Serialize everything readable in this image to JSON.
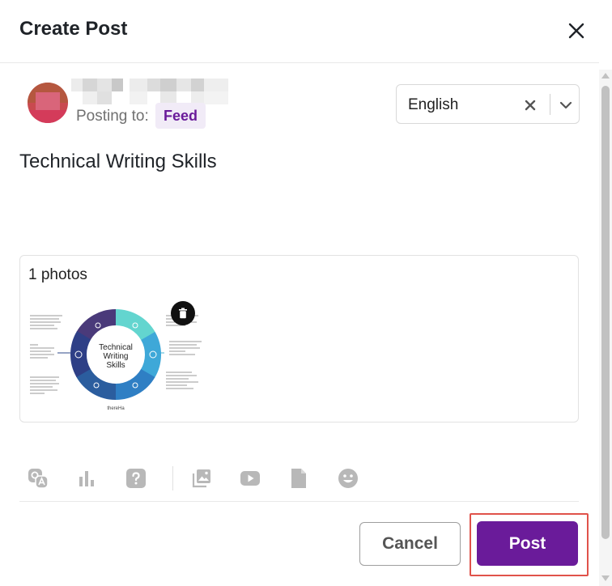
{
  "dialog": {
    "title": "Create Post",
    "close_icon": "close-icon"
  },
  "author": {
    "posting_to_label": "Posting to:",
    "destination": "Feed"
  },
  "language": {
    "selected": "English",
    "clear_icon": "clear-icon",
    "dropdown_icon": "chevron-down-icon"
  },
  "post": {
    "text": "Technical Writing Skills"
  },
  "attachments": {
    "count_label": "1 photos",
    "thumbnail": {
      "center_title": "Technical Writing Skills",
      "footer": "thereHa"
    },
    "delete_icon": "trash-icon"
  },
  "toolbar": {
    "tools": [
      {
        "icon": "qa-icon"
      },
      {
        "icon": "poll-icon"
      },
      {
        "icon": "question-icon"
      },
      {
        "icon": "photo-gallery-icon"
      },
      {
        "icon": "video-icon"
      },
      {
        "icon": "document-icon"
      },
      {
        "icon": "emoji-icon"
      }
    ]
  },
  "actions": {
    "cancel_label": "Cancel",
    "post_label": "Post"
  },
  "colors": {
    "brand": "#6a1b9a",
    "badge_bg": "#f1ebf7",
    "highlight": "#e0524a"
  }
}
